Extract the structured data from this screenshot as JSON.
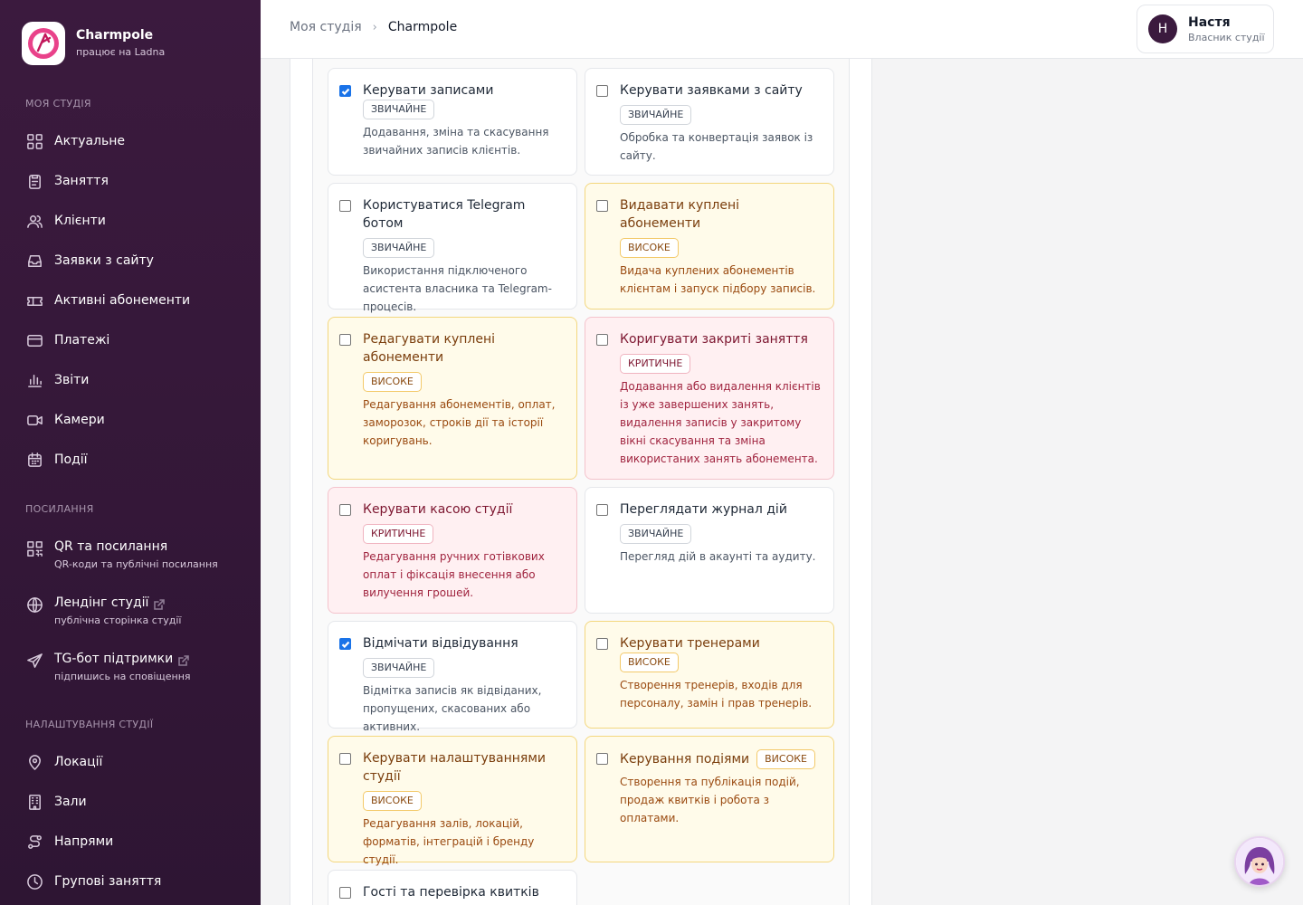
{
  "brand": {
    "name": "Charmpole",
    "sub": "працює на Ladna"
  },
  "sidebar": {
    "section_studio": "Моя студія",
    "items": [
      {
        "label": "Актуальне",
        "icon": "grid-icon"
      },
      {
        "label": "Заняття",
        "icon": "clipboard-icon"
      },
      {
        "label": "Клієнти",
        "icon": "users-icon"
      },
      {
        "label": "Заявки з сайту",
        "icon": "inbox-icon"
      },
      {
        "label": "Активні абонементи",
        "icon": "ticket-icon"
      },
      {
        "label": "Платежі",
        "icon": "card-icon"
      },
      {
        "label": "Звіти",
        "icon": "bar-chart-icon"
      },
      {
        "label": "Камери",
        "icon": "video-icon"
      },
      {
        "label": "Події",
        "icon": "calendar-icon"
      }
    ],
    "section_links": "Посилання",
    "links": [
      {
        "title": "QR та посилання",
        "sub": "QR-коди та публічні посилання",
        "icon": "qr-icon",
        "external": false
      },
      {
        "title": "Лендінг студії",
        "sub": "публічна сторінка студії",
        "icon": "globe-icon",
        "external": true
      },
      {
        "title": "TG-бот підтримки",
        "sub": "підпишись на сповіщення",
        "icon": "send-icon",
        "external": true
      }
    ],
    "section_settings": "Налаштування студії",
    "settings": [
      {
        "label": "Локації",
        "icon": "map-pin-icon"
      },
      {
        "label": "Зали",
        "icon": "building-icon"
      },
      {
        "label": "Напрями",
        "icon": "route-icon"
      },
      {
        "label": "Групові заняття",
        "icon": "clock-icon"
      }
    ]
  },
  "header": {
    "crumb_root": "Моя студія",
    "crumb_current": "Charmpole",
    "user_initial": "Н",
    "user_name": "Настя",
    "user_role": "Власник студії"
  },
  "permissions": [
    {
      "title": "Керувати записами",
      "badge": "ЗВИЧАЙНЕ",
      "level": "normal",
      "checked": true,
      "desc": "Додавання, зміна та скасування звичайних записів клієнтів."
    },
    {
      "title": "Керувати заявками з сайту",
      "badge": "ЗВИЧАЙНЕ",
      "level": "normal",
      "checked": false,
      "desc": "Обробка та конвертація заявок із сайту."
    },
    {
      "title": "Користуватися Telegram ботом",
      "badge": "ЗВИЧАЙНЕ",
      "level": "normal",
      "checked": false,
      "desc": "Використання підключеного асистента власника та Telegram-процесів."
    },
    {
      "title": "Видавати куплені абонементи",
      "badge": "ВИСОКЕ",
      "level": "high",
      "checked": false,
      "desc": "Видача куплених абонементів клієнтам і запуск підбору записів."
    },
    {
      "title": "Редагувати куплені абонементи",
      "badge": "ВИСОКЕ",
      "level": "high",
      "checked": false,
      "desc": "Редагування абонементів, оплат, заморозок, строків дії та історії коригувань."
    },
    {
      "title": "Коригувати закриті заняття",
      "badge": "КРИТИЧНЕ",
      "level": "crit",
      "checked": false,
      "desc": "Додавання або видалення клієнтів із уже завершених занять, видалення записів у закритому вікні скасування та зміна використаних занять абонемента."
    },
    {
      "title": "Керувати касою студії",
      "badge": "КРИТИЧНЕ",
      "level": "crit",
      "checked": false,
      "desc": "Редагування ручних готівкових оплат і фіксація внесення або вилучення грошей."
    },
    {
      "title": "Переглядати журнал дій",
      "badge": "ЗВИЧАЙНЕ",
      "level": "normal",
      "checked": false,
      "desc": "Перегляд дій в акаунті та аудиту."
    },
    {
      "title": "Відмічати відвідування",
      "badge": "ЗВИЧАЙНЕ",
      "level": "normal",
      "checked": true,
      "desc": "Відмітка записів як відвіданих, пропущених, скасованих або активних."
    },
    {
      "title": "Керувати тренерами",
      "badge": "ВИСОКЕ",
      "level": "high",
      "checked": false,
      "desc": "Створення тренерів, входів для персоналу, замін і прав тренерів."
    },
    {
      "title": "Керувати налаштуваннями студії",
      "badge": "ВИСОКЕ",
      "level": "high",
      "checked": false,
      "desc": "Редагування залів, локацій, форматів, інтеграцій і бренду студії."
    },
    {
      "title": "Керування подіями",
      "badge": "ВИСОКЕ",
      "level": "high",
      "checked": false,
      "desc": "Створення та публікація подій, продаж квитків і робота з оплатами."
    },
    {
      "title": "Гості та перевірка квитків",
      "badge": "",
      "level": "normal",
      "checked": false,
      "desc": ""
    }
  ],
  "colors": {
    "sidebar_bg": "#3b1a3e",
    "accent": "#c2185b",
    "high_bg": "#fffbea",
    "crit_bg": "#fff0f2"
  },
  "chat": {
    "icon": "assistant-avatar-icon"
  }
}
